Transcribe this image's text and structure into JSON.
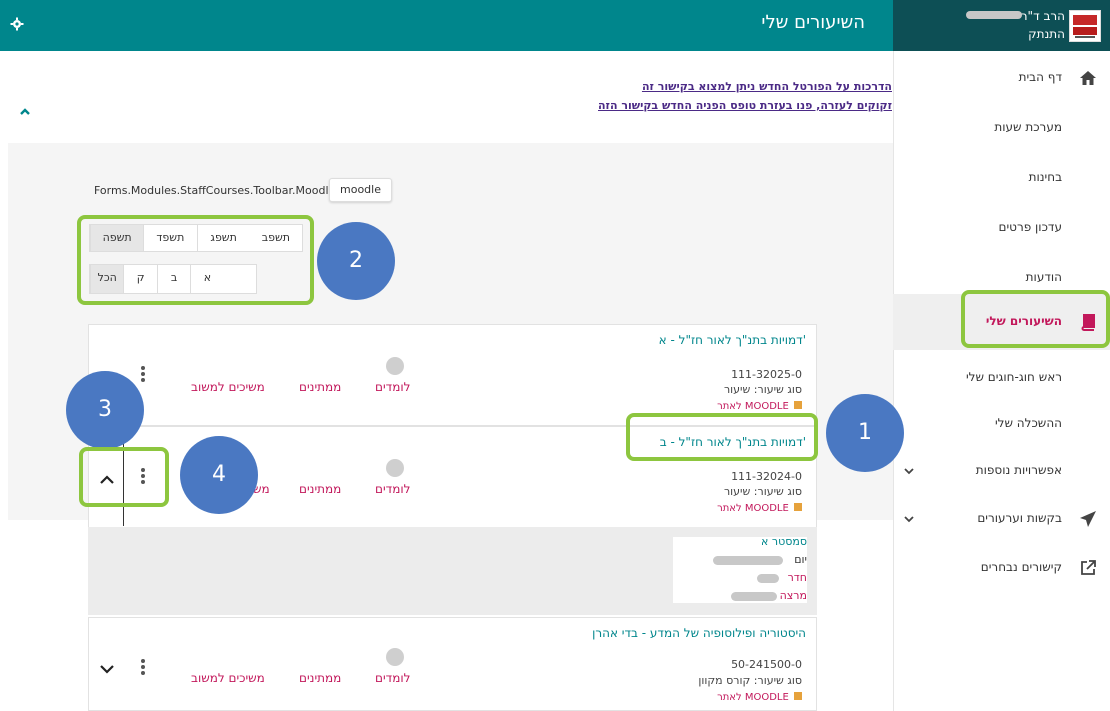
{
  "header": {
    "title": "השיעורים שלי",
    "user_name": "הרב ד\"ר",
    "logout": "התנתק"
  },
  "sidebar": {
    "items": [
      {
        "label": "דף הבית",
        "icon": "home-icon"
      },
      {
        "label": "מערכת שעות"
      },
      {
        "label": "בחינות"
      },
      {
        "label": "עדכון פרטים"
      },
      {
        "label": "הודעות"
      },
      {
        "label": "השיעורים שלי",
        "icon": "book-icon",
        "active": true
      },
      {
        "label": "ראש חוג-חוגים שלי"
      },
      {
        "label": "ההשכלה שלי"
      },
      {
        "label": "אפשרויות נוספות",
        "has_chevron": true
      },
      {
        "label": "בקשות וערעורים",
        "icon": "send-icon",
        "has_chevron": true
      },
      {
        "label": "קישורים נבחרים",
        "icon": "external-link-icon"
      }
    ]
  },
  "notice": {
    "line1": "הדרכות על הפורטל החדש ניתן למצוא בקישור זה",
    "line2": "זקוקים לעזרה, פנו בעזרת טופס הפניה החדש בקישור הזה"
  },
  "toolbar": {
    "path_text": "Forms.Modules.StaffCourses.Toolbar.MoodleKT",
    "moodle_button": "moodle"
  },
  "years": [
    "תשפב",
    "תשפג",
    "תשפד",
    "תשפה"
  ],
  "grades": [
    "",
    "א",
    "ב",
    "ק",
    "הכל"
  ],
  "callouts": {
    "one": "1",
    "two": "2",
    "three": "3",
    "four": "4"
  },
  "courses": [
    {
      "title": "דמויות בתנ\"ך לאור חז\"ל - א'",
      "code": "111-32025-0",
      "type": "סוג שיעור:  שיעור",
      "moodle": "לאתר MOODLE",
      "learners": "לומדים",
      "waiting": "ממתינים",
      "continuing": "משיכים למשוב"
    },
    {
      "title": "דמויות בתנ\"ך לאור חז\"ל - ב'",
      "code": "111-32024-0",
      "type": "סוג שיעור:  שיעור",
      "moodle": "לאתר MOODLE",
      "learners": "לומדים",
      "waiting": "ממתינים",
      "continuing": "מש"
    },
    {
      "title": "היסטוריה ופילוסופיה של המדע - בדי אהרן",
      "code": "50-241500-0",
      "type": "סוג שיעור:  קורס מקוון",
      "moodle": "לאתר MOODLE",
      "learners": "לומדים",
      "waiting": "ממתינים",
      "continuing": "משיכים למשוב"
    }
  ],
  "detail": {
    "semester": "סמסטר  א",
    "day": "יום",
    "room": "חדר",
    "lecturer": "מרצה"
  },
  "colors": {
    "teal": "#00868c",
    "dark_teal": "#0d4f55",
    "magenta": "#c2185b",
    "highlight": "#8dc63f",
    "callout": "#4a78c2"
  }
}
